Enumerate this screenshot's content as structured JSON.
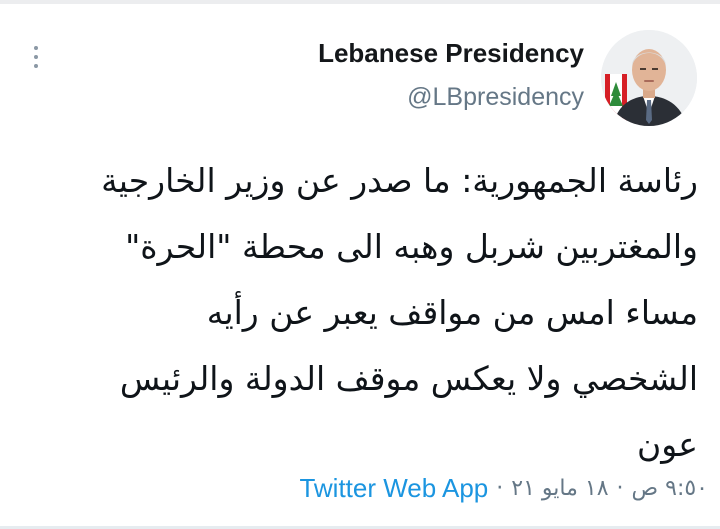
{
  "account": {
    "display_name": "Lebanese Presidency",
    "handle": "@LBpresidency",
    "avatar": "profile-photo"
  },
  "more_menu": {
    "icon": "more-vertical-icon"
  },
  "tweet": {
    "lines": [
      "رئاسة الجمهورية: ما صدر عن وزير الخارجية",
      "والمغتربين شربل وهبه الى محطة \"الحرة\"",
      "مساء امس من مواقف يعبر عن رأيه",
      "الشخصي ولا يعكس موقف الدولة والرئيس",
      "عون"
    ]
  },
  "meta": {
    "time": "٩:٥٠ ص",
    "date": "١٨ مايو ٢١",
    "separator": "·",
    "source": "Twitter Web App"
  },
  "colors": {
    "text": "#0f1419",
    "secondary": "#657786",
    "link": "#1b95e0"
  }
}
